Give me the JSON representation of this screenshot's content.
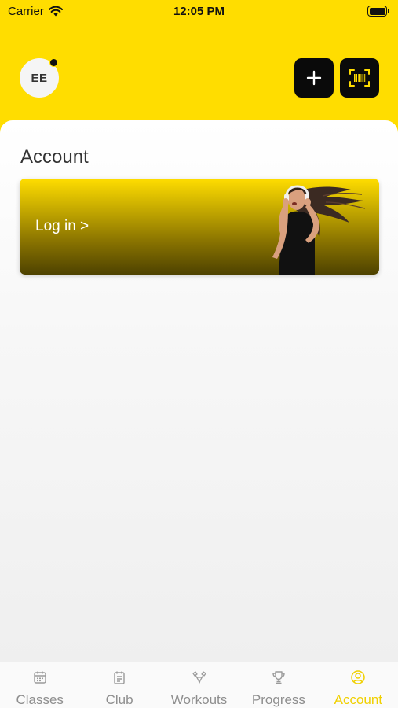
{
  "status_bar": {
    "carrier": "Carrier",
    "time": "12:05 PM"
  },
  "header": {
    "avatar_initials": "EE",
    "add_icon": "plus-icon",
    "scan_icon": "barcode-scan-icon"
  },
  "main": {
    "title": "Account",
    "login_banner": {
      "label": "Log in >"
    }
  },
  "tab_bar": {
    "tabs": [
      {
        "label": "Classes",
        "icon": "calendar-icon",
        "active": false
      },
      {
        "label": "Club",
        "icon": "club-icon",
        "active": false
      },
      {
        "label": "Workouts",
        "icon": "workouts-icon",
        "active": false
      },
      {
        "label": "Progress",
        "icon": "trophy-icon",
        "active": false
      },
      {
        "label": "Account",
        "icon": "user-circle-icon",
        "active": true
      }
    ]
  },
  "colors": {
    "brand_yellow": "#FFDD00",
    "active_tab": "#F0D000",
    "inactive_tab": "#8e8e8e",
    "button_dark": "#0a0a0a"
  }
}
